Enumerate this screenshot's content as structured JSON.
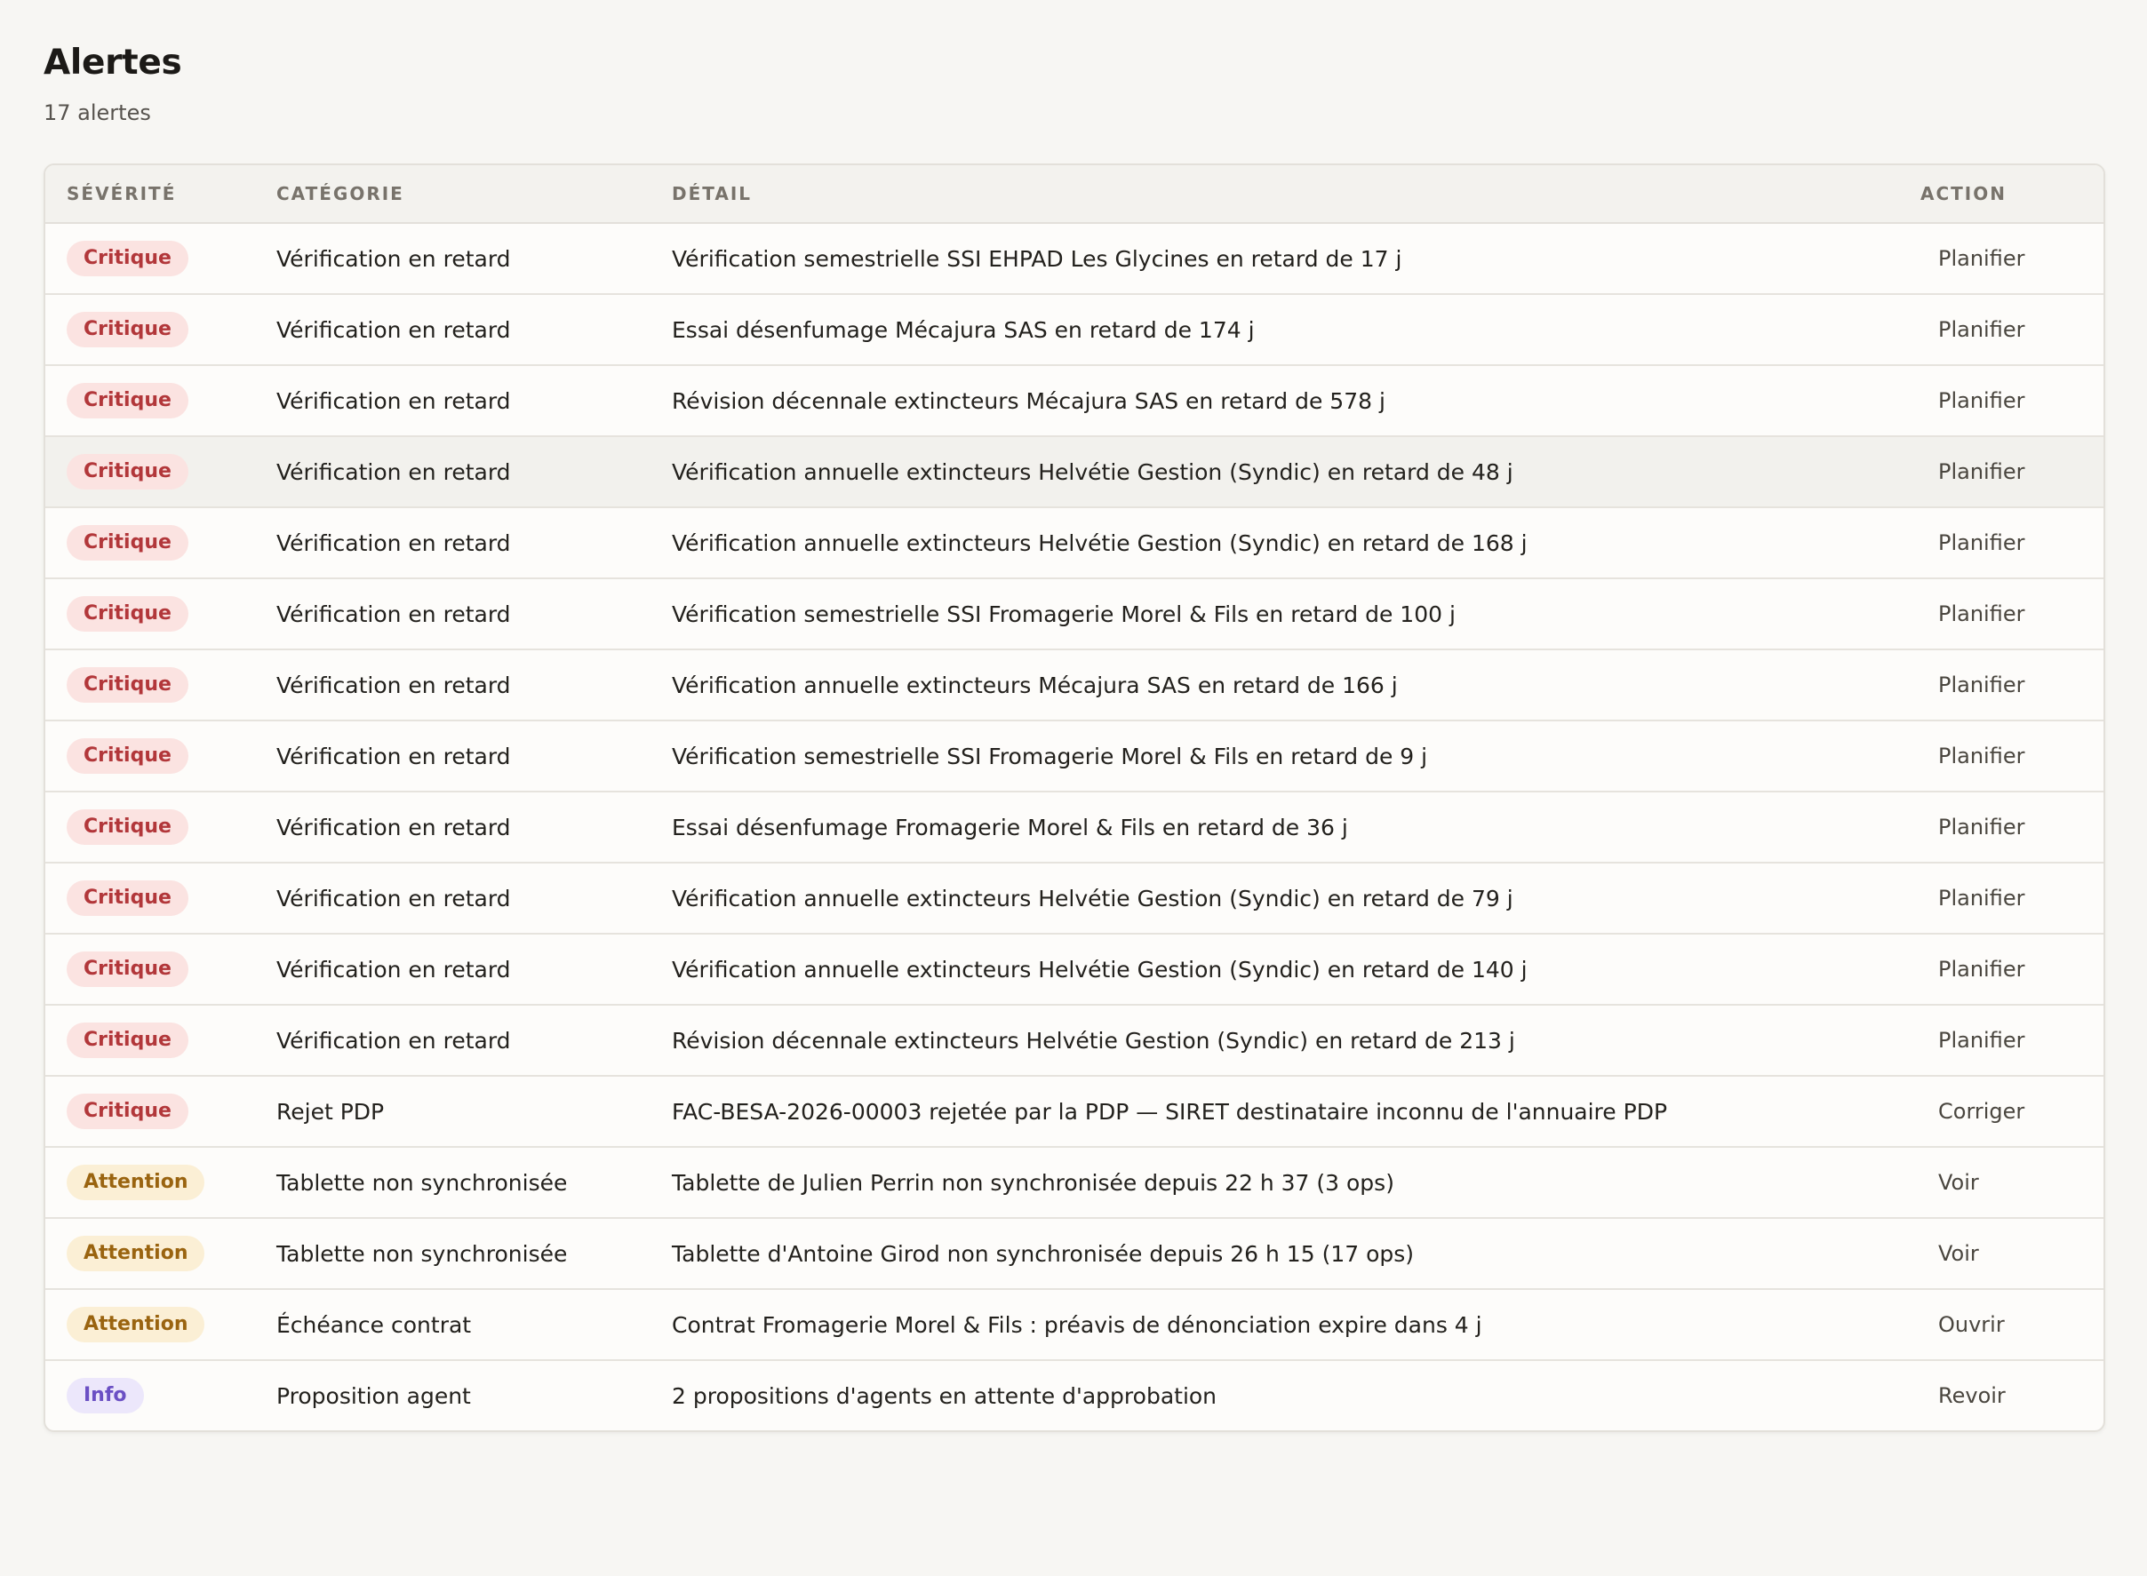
{
  "page": {
    "title": "Alertes",
    "count_label": "17 alertes"
  },
  "table": {
    "headers": {
      "severity": "Sévérité",
      "category": "Catégorie",
      "detail": "Détail",
      "action": "Action"
    },
    "rows": [
      {
        "severity": "Critique",
        "level": "critique",
        "category": "Vérification en retard",
        "detail": "Vérification semestrielle SSI EHPAD Les Glycines en retard de 17 j",
        "action": "Planifier"
      },
      {
        "severity": "Critique",
        "level": "critique",
        "category": "Vérification en retard",
        "detail": "Essai désenfumage Mécajura SAS en retard de 174 j",
        "action": "Planifier"
      },
      {
        "severity": "Critique",
        "level": "critique",
        "category": "Vérification en retard",
        "detail": "Révision décennale extincteurs Mécajura SAS en retard de 578 j",
        "action": "Planifier"
      },
      {
        "severity": "Critique",
        "level": "critique",
        "category": "Vérification en retard",
        "detail": "Vérification annuelle extincteurs Helvétie Gestion (Syndic) en retard de 48 j",
        "action": "Planifier"
      },
      {
        "severity": "Critique",
        "level": "critique",
        "category": "Vérification en retard",
        "detail": "Vérification annuelle extincteurs Helvétie Gestion (Syndic) en retard de 168 j",
        "action": "Planifier"
      },
      {
        "severity": "Critique",
        "level": "critique",
        "category": "Vérification en retard",
        "detail": "Vérification semestrielle SSI Fromagerie Morel & Fils en retard de 100 j",
        "action": "Planifier"
      },
      {
        "severity": "Critique",
        "level": "critique",
        "category": "Vérification en retard",
        "detail": "Vérification annuelle extincteurs Mécajura SAS en retard de 166 j",
        "action": "Planifier"
      },
      {
        "severity": "Critique",
        "level": "critique",
        "category": "Vérification en retard",
        "detail": "Vérification semestrielle SSI Fromagerie Morel & Fils en retard de 9 j",
        "action": "Planifier"
      },
      {
        "severity": "Critique",
        "level": "critique",
        "category": "Vérification en retard",
        "detail": "Essai désenfumage Fromagerie Morel & Fils en retard de 36 j",
        "action": "Planifier"
      },
      {
        "severity": "Critique",
        "level": "critique",
        "category": "Vérification en retard",
        "detail": "Vérification annuelle extincteurs Helvétie Gestion (Syndic) en retard de 79 j",
        "action": "Planifier"
      },
      {
        "severity": "Critique",
        "level": "critique",
        "category": "Vérification en retard",
        "detail": "Vérification annuelle extincteurs Helvétie Gestion (Syndic) en retard de 140 j",
        "action": "Planifier"
      },
      {
        "severity": "Critique",
        "level": "critique",
        "category": "Vérification en retard",
        "detail": "Révision décennale extincteurs Helvétie Gestion (Syndic) en retard de 213 j",
        "action": "Planifier"
      },
      {
        "severity": "Critique",
        "level": "critique",
        "category": "Rejet PDP",
        "detail": "FAC-BESA-2026-00003 rejetée par la PDP — SIRET destinataire inconnu de l'annuaire PDP",
        "action": "Corriger"
      },
      {
        "severity": "Attention",
        "level": "attention",
        "category": "Tablette non synchronisée",
        "detail": "Tablette de Julien Perrin non synchronisée depuis 22 h 37 (3 ops)",
        "action": "Voir"
      },
      {
        "severity": "Attention",
        "level": "attention",
        "category": "Tablette non synchronisée",
        "detail": "Tablette d'Antoine Girod non synchronisée depuis 26 h 15 (17 ops)",
        "action": "Voir"
      },
      {
        "severity": "Attention",
        "level": "attention",
        "category": "Échéance contrat",
        "detail": "Contrat Fromagerie Morel & Fils : préavis de dénonciation expire dans 4 j",
        "action": "Ouvrir"
      },
      {
        "severity": "Info",
        "level": "info",
        "category": "Proposition agent",
        "detail": "2 propositions d'agents en attente d'approbation",
        "action": "Revoir"
      }
    ]
  },
  "colors": {
    "critique_bg": "#fbe3e1",
    "critique_fg": "#b2373a",
    "attention_bg": "#fbefd5",
    "attention_fg": "#9a6410",
    "info_bg": "#ece7fb",
    "info_fg": "#6b50c4"
  }
}
